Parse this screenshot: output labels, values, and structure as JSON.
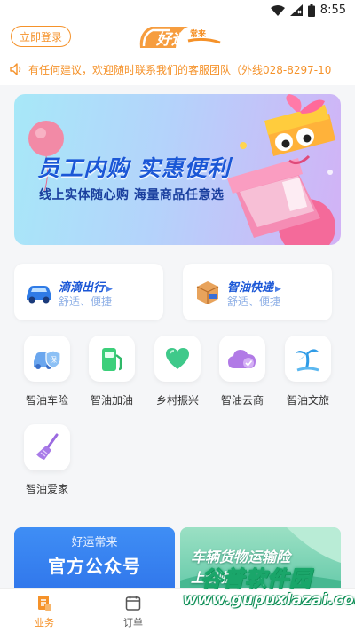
{
  "status_bar": {
    "time": "8:55"
  },
  "header": {
    "login_label": "立即登录",
    "logo_text": "好运常来"
  },
  "notice": {
    "text": "有任何建议，欢迎随时联系我们的客服团队（外线028-8297-10"
  },
  "banner": {
    "title": "员工内购 实惠便利",
    "subtitle": "线上实体随心购 海量商品任意选"
  },
  "services": [
    {
      "title": "滴滴出行",
      "subtitle": "舒适、便捷",
      "icon": "car-icon"
    },
    {
      "title": "智油快递",
      "subtitle": "舒适、便捷",
      "icon": "package-icon"
    }
  ],
  "grid": [
    {
      "label": "智油车险",
      "icon": "car-insurance-icon"
    },
    {
      "label": "智油加油",
      "icon": "fuel-pump-icon"
    },
    {
      "label": "乡村振兴",
      "icon": "heart-icon"
    },
    {
      "label": "智油云商",
      "icon": "cloud-icon"
    },
    {
      "label": "智油文旅",
      "icon": "palm-tree-icon"
    },
    {
      "label": "智油爱家",
      "icon": "broom-icon"
    }
  ],
  "promos": {
    "left_line1": "好运常来",
    "left_line2": "官方公众号",
    "right_line1": "车辆货物运输险",
    "right_line2": "上线啦"
  },
  "watermark": {
    "title": "谷普软件园",
    "url": "www.gupuxlazai.com"
  },
  "tabbar": [
    {
      "label": "业务",
      "icon": "business-icon",
      "active": true
    },
    {
      "label": "订单",
      "icon": "calendar-icon",
      "active": false
    }
  ],
  "colors": {
    "accent": "#f5922a",
    "primary_blue": "#1b57d6",
    "active_tab": "#f5922a",
    "inactive_tab": "#555555"
  }
}
